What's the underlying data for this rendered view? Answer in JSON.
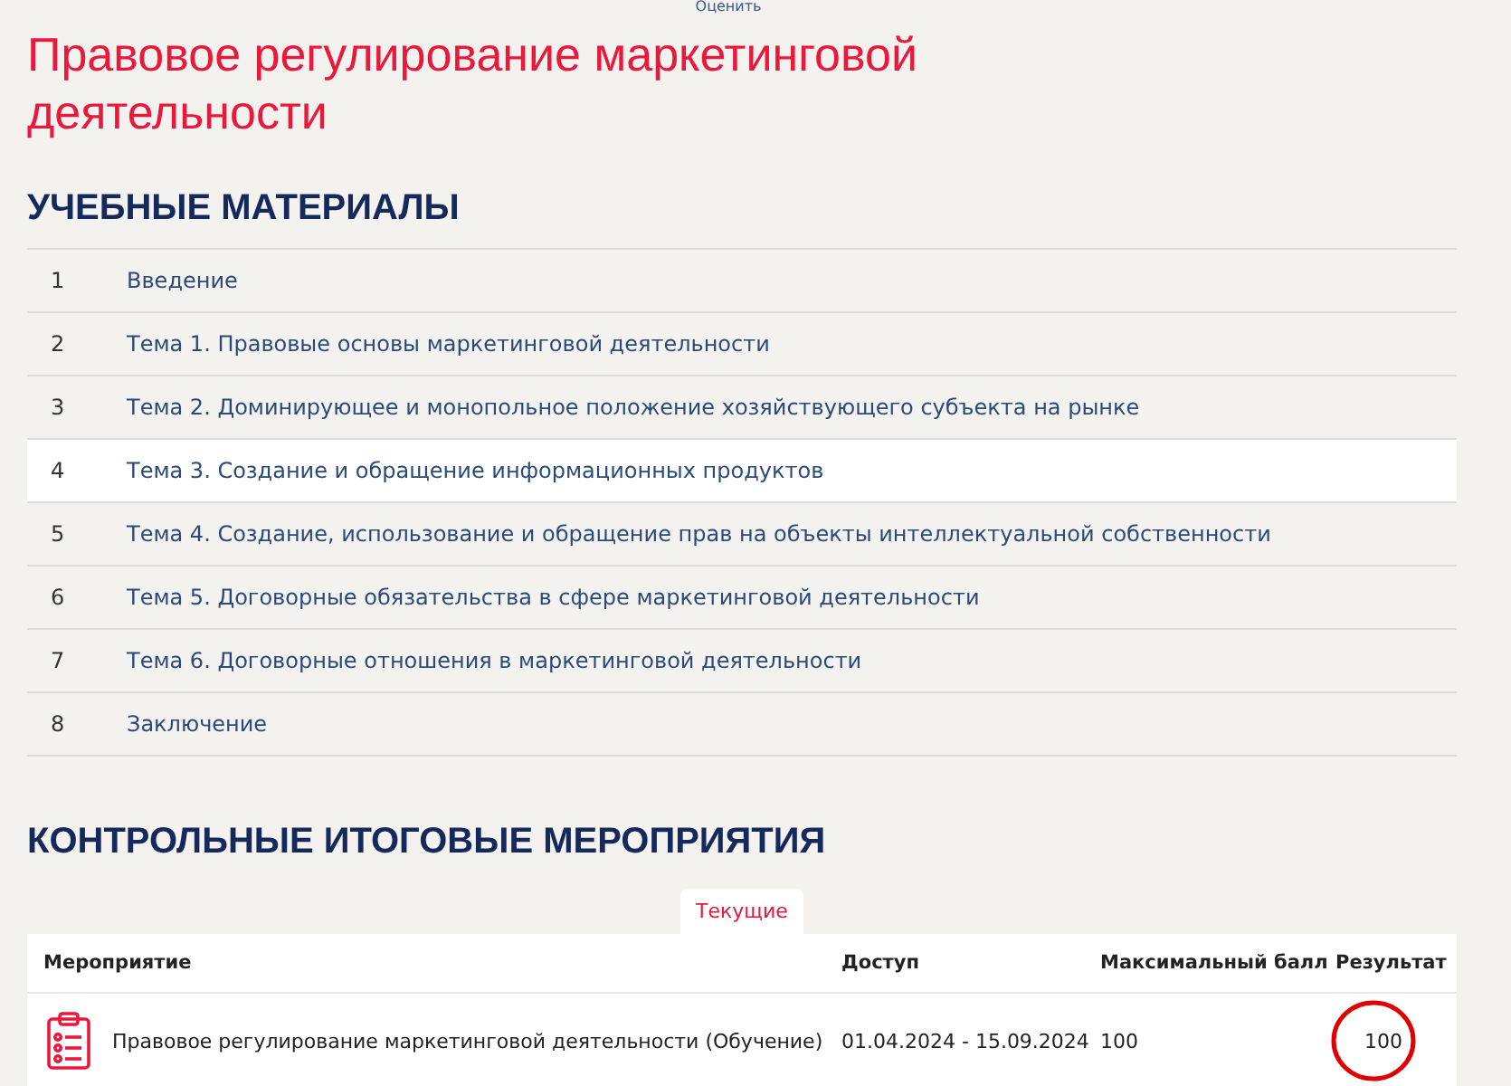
{
  "top_link": "Оценить",
  "title": "Правовое регулирование маркетинговой деятельности",
  "materials": {
    "heading": "УЧЕБНЫЕ МАТЕРИАЛЫ",
    "items": [
      {
        "number": "1",
        "label": "Введение",
        "selected": false
      },
      {
        "number": "2",
        "label": "Тема 1. Правовые основы маркетинговой деятельности",
        "selected": false
      },
      {
        "number": "3",
        "label": "Тема 2. Доминирующее и монопольное положение хозяйствующего субъекта на рынке",
        "selected": false
      },
      {
        "number": "4",
        "label": "Тема 3. Создание и обращение информационных продуктов",
        "selected": true
      },
      {
        "number": "5",
        "label": "Тема 4. Создание, использование и обращение прав на объекты интеллектуальной собственности",
        "selected": false
      },
      {
        "number": "6",
        "label": "Тема 5. Договорные обязательства в сфере маркетинговой деятельности",
        "selected": false
      },
      {
        "number": "7",
        "label": "Тема 6. Договорные отношения в маркетинговой деятельности",
        "selected": false
      },
      {
        "number": "8",
        "label": "Заключение",
        "selected": false
      }
    ]
  },
  "events": {
    "heading": "КОНТРОЛЬНЫЕ ИТОГОВЫЕ МЕРОПРИЯТИЯ",
    "tabs": [
      {
        "label": "Текущие",
        "selected": true
      }
    ],
    "columns": [
      "Мероприятие",
      "Доступ",
      "Максимальный балл",
      "Результат"
    ],
    "rows": [
      {
        "name": "Правовое регулирование маркетинговой деятельности (Обучение)",
        "access": "01.04.2024 - 15.09.2024",
        "max_score": "100",
        "result": "100",
        "circled": true
      }
    ]
  }
}
